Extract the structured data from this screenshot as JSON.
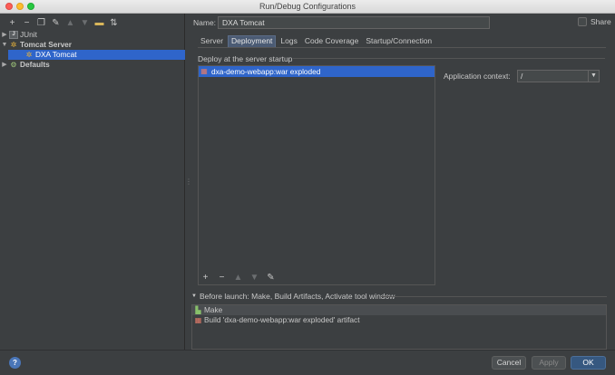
{
  "window": {
    "title": "Run/Debug Configurations"
  },
  "toolbar": {
    "icons": [
      "plus-icon",
      "minus-icon",
      "copy-icon",
      "wrench-icon",
      "up-arrow-icon",
      "down-arrow-icon",
      "folder-icon",
      "sort-icon"
    ]
  },
  "tree": {
    "items": [
      {
        "label": "JUnit",
        "level": 0,
        "expanded": false
      },
      {
        "label": "Tomcat Server",
        "level": 0,
        "expanded": true
      },
      {
        "label": "DXA Tomcat",
        "level": 1,
        "selected": true
      },
      {
        "label": "Defaults",
        "level": 0,
        "expanded": false
      }
    ]
  },
  "config": {
    "name_label": "Name:",
    "name_value": "DXA Tomcat",
    "share_label": "Share"
  },
  "tabs": [
    "Server",
    "Deployment",
    "Logs",
    "Code Coverage",
    "Startup/Connection"
  ],
  "active_tab": "Deployment",
  "deployment": {
    "section_title": "Deploy at the server startup",
    "items": [
      "dxa-demo-webapp:war exploded"
    ],
    "context_label": "Application context:",
    "context_value": "/"
  },
  "before_launch": {
    "title": "Before launch: Make, Build Artifacts, Activate tool window",
    "items": [
      "Make",
      "Build 'dxa-demo-webapp:war exploded' artifact"
    ]
  },
  "buttons": {
    "help": "?",
    "cancel": "Cancel",
    "apply": "Apply",
    "ok": "OK"
  },
  "colors": {
    "selection": "#2f65ca",
    "background": "#3c3f41",
    "ok_button": "#365880"
  }
}
